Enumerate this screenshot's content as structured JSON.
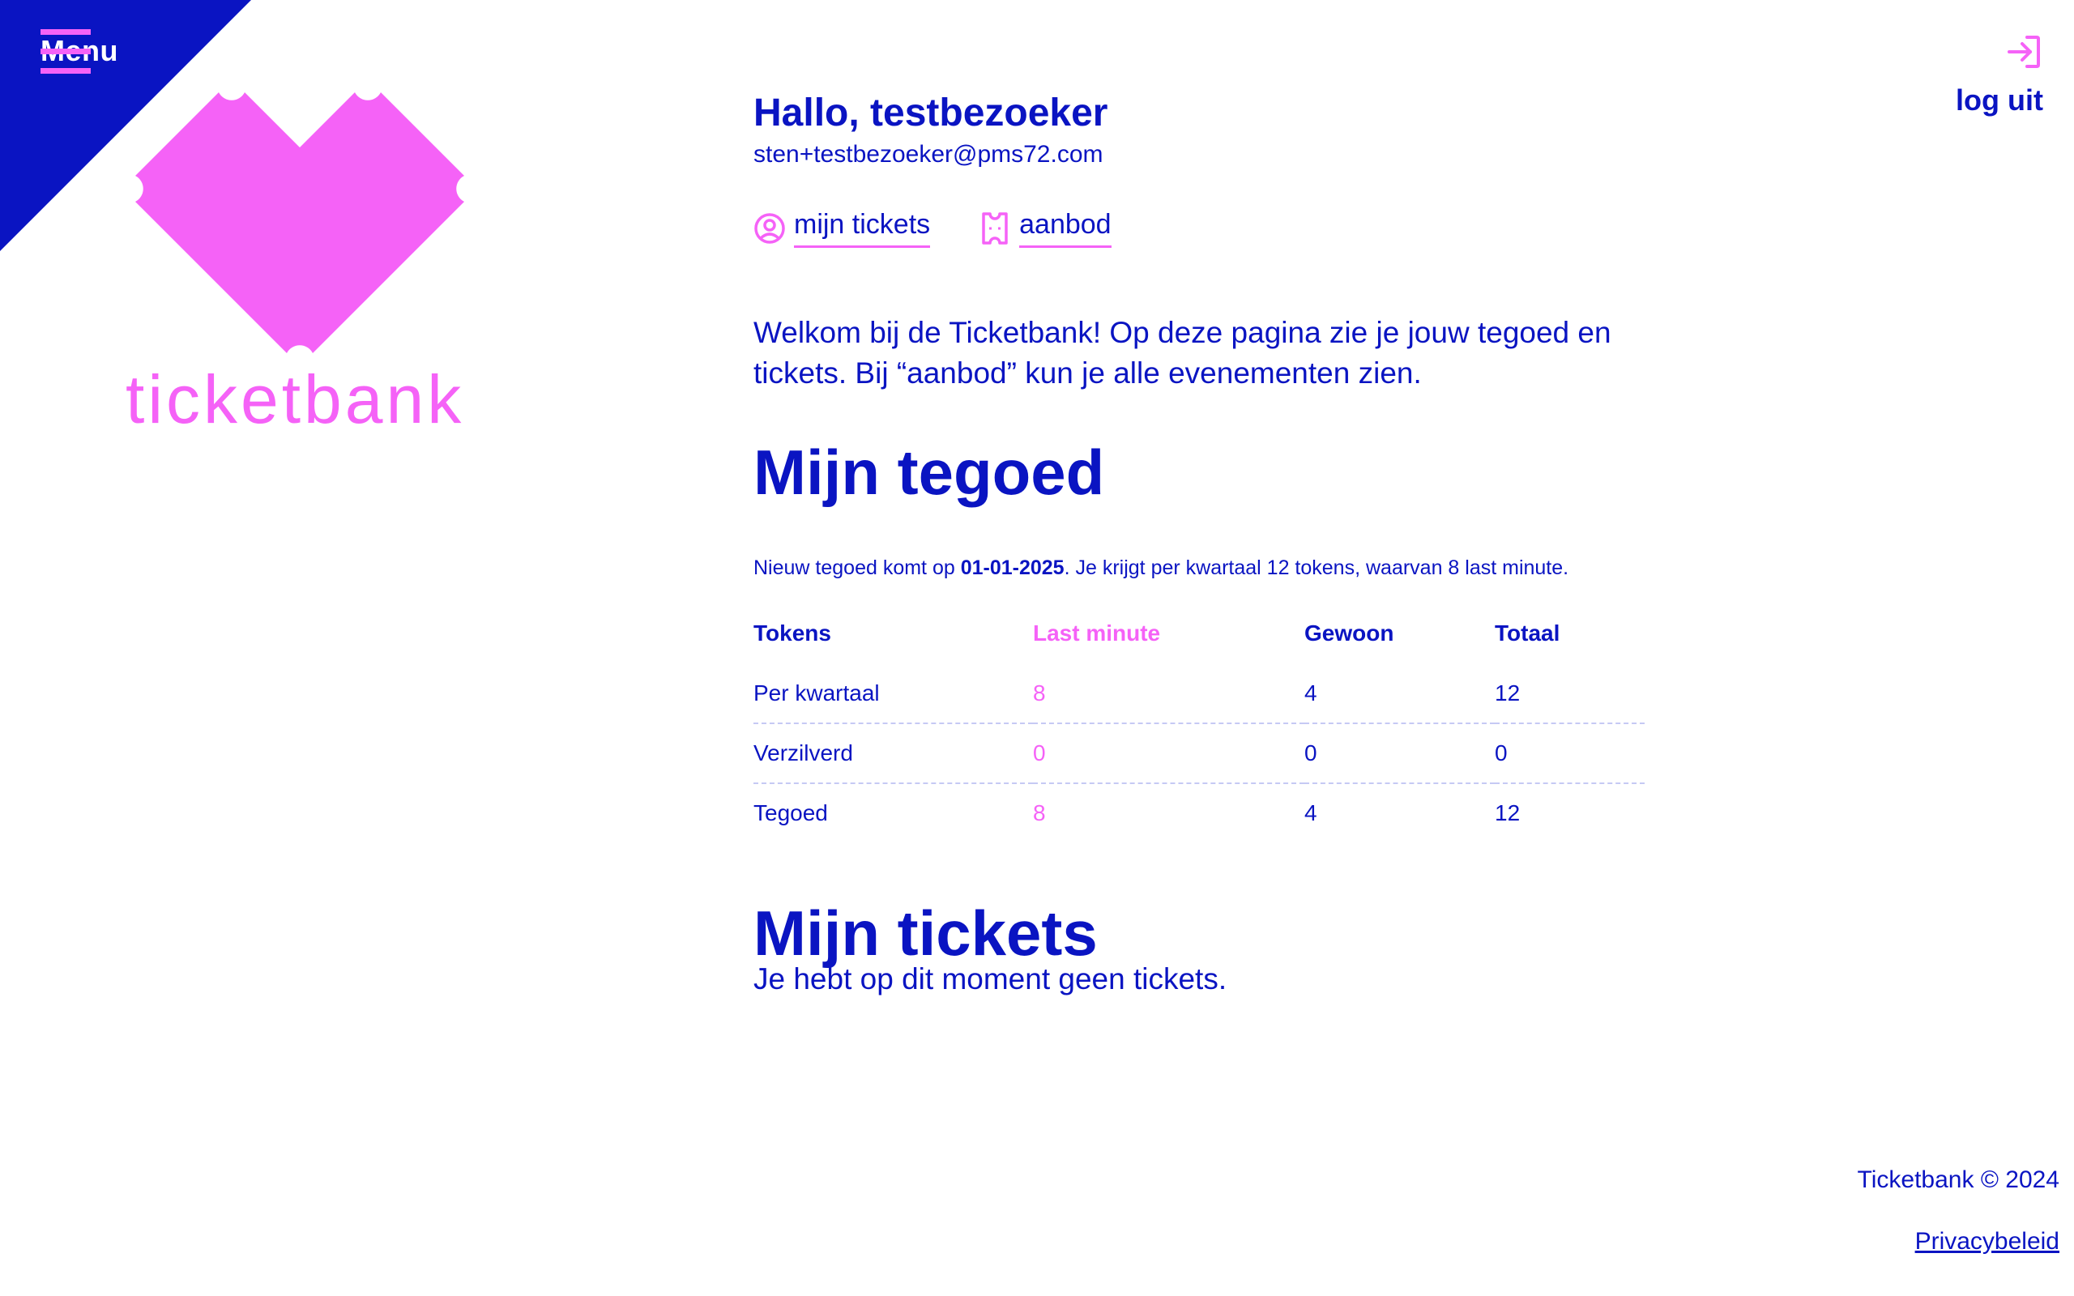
{
  "colors": {
    "primary": "#0a14c2",
    "accent": "#f562f7",
    "background": "#ffffff"
  },
  "nav": {
    "menu_label": "Menu",
    "logo_text": "ticketbank",
    "logout_label": "log uit"
  },
  "user": {
    "greeting": "Hallo, testbezoeker",
    "email": "sten+testbezoeker@pms72.com"
  },
  "tabs": [
    {
      "label": "mijn tickets",
      "icon": "user-circle-icon"
    },
    {
      "label": "aanbod",
      "icon": "ticket-icon"
    }
  ],
  "intro": "Welkom bij de Ticketbank! Op deze pagina zie je jouw tegoed en tickets. Bij “aanbod” kun je alle evenementen zien.",
  "tegoed": {
    "heading": "Mijn tegoed",
    "note_prefix": "Nieuw tegoed komt op ",
    "note_date": "01-01-2025",
    "note_suffix": ". Je krijgt per kwartaal 12 tokens, waarvan 8 last minute.",
    "headers": [
      "Tokens",
      "Last minute",
      "Gewoon",
      "Totaal"
    ],
    "rows": [
      [
        "Per kwartaal",
        "8",
        "4",
        "12"
      ],
      [
        "Verzilverd",
        "0",
        "0",
        "0"
      ],
      [
        "Tegoed",
        "8",
        "4",
        "12"
      ]
    ]
  },
  "tickets": {
    "heading": "Mijn tickets",
    "empty_text": "Je hebt op dit moment geen tickets."
  },
  "footer": {
    "copyright": "Ticketbank © 2024",
    "privacy": "Privacybeleid"
  }
}
